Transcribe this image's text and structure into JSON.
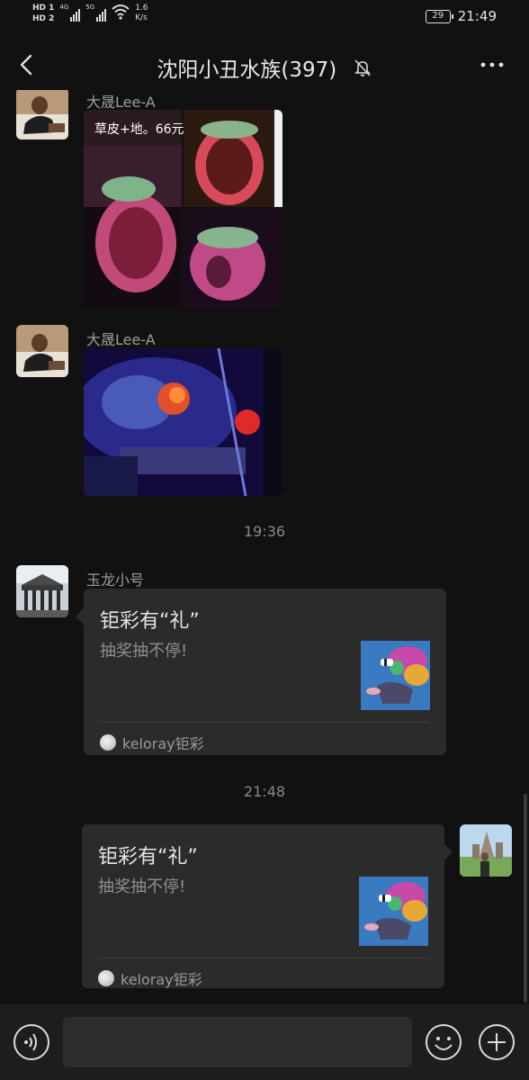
{
  "status_bar": {
    "hd1": "HD 1",
    "hd2": "HD 2",
    "net1": "4G",
    "net2": "5G",
    "speed_value": "1.6",
    "speed_unit": "K/s",
    "battery": "29",
    "time": "21:49"
  },
  "header": {
    "title": "沈阳小丑水族(397)",
    "back_icon": "chevron-left-icon",
    "mute_icon": "bell-off-icon",
    "more_icon": "more-dots-icon"
  },
  "messages": [
    {
      "sender": "大晟Lee-A",
      "type": "image",
      "image_caption": "草皮+地。66元"
    },
    {
      "sender": "大晟Lee-A",
      "type": "image"
    },
    {
      "type": "timestamp",
      "text": "19:36"
    },
    {
      "sender": "玉龙小号",
      "type": "card",
      "title": "钜彩有“礼”",
      "desc": "抽奖抽不停!",
      "source": "keloray钜彩"
    },
    {
      "type": "timestamp",
      "text": "21:48"
    },
    {
      "sender": "self",
      "type": "card",
      "title": "钜彩有“礼”",
      "desc": "抽奖抽不停!",
      "source": "keloray钜彩"
    }
  ],
  "input_bar": {
    "voice_icon": "voice-icon",
    "emoji_icon": "emoji-icon",
    "plus_icon": "plus-icon",
    "placeholder": ""
  },
  "colors": {
    "background": "#111111",
    "bubble": "#2b2b2b",
    "input_bar": "#1d1d1d"
  }
}
